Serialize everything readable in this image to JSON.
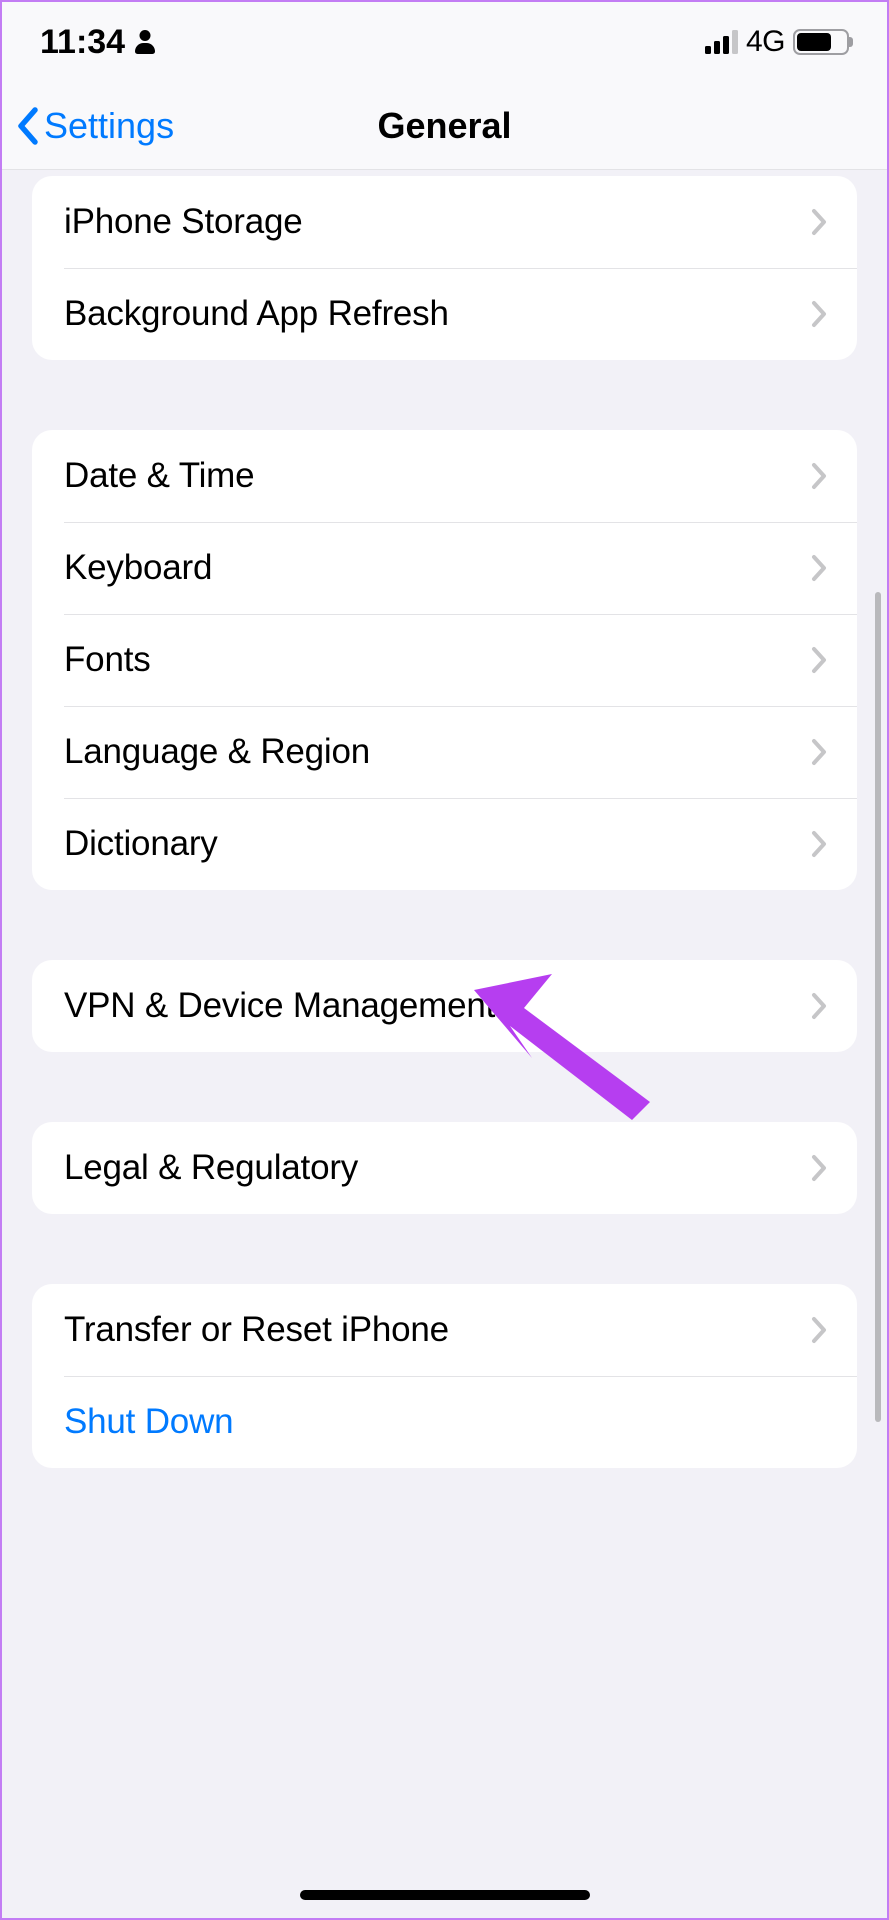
{
  "status": {
    "time": "11:34",
    "network_label": "4G"
  },
  "nav": {
    "back_label": "Settings",
    "title": "General"
  },
  "groups": [
    {
      "id": "storage",
      "rows": [
        {
          "id": "iphone-storage",
          "label": "iPhone Storage",
          "chevron": true
        },
        {
          "id": "background-app-refresh",
          "label": "Background App Refresh",
          "chevron": true
        }
      ]
    },
    {
      "id": "system",
      "rows": [
        {
          "id": "date-time",
          "label": "Date & Time",
          "chevron": true
        },
        {
          "id": "keyboard",
          "label": "Keyboard",
          "chevron": true
        },
        {
          "id": "fonts",
          "label": "Fonts",
          "chevron": true
        },
        {
          "id": "language-region",
          "label": "Language & Region",
          "chevron": true
        },
        {
          "id": "dictionary",
          "label": "Dictionary",
          "chevron": true
        }
      ]
    },
    {
      "id": "vpn",
      "rows": [
        {
          "id": "vpn-device-management",
          "label": "VPN & Device Management",
          "chevron": true
        }
      ]
    },
    {
      "id": "legal",
      "rows": [
        {
          "id": "legal-regulatory",
          "label": "Legal & Regulatory",
          "chevron": true
        }
      ]
    },
    {
      "id": "reset",
      "rows": [
        {
          "id": "transfer-or-reset",
          "label": "Transfer or Reset iPhone",
          "chevron": true
        },
        {
          "id": "shut-down",
          "label": "Shut Down",
          "chevron": false,
          "style": "blue"
        }
      ]
    }
  ],
  "annotation": {
    "color": "#b63ef0"
  }
}
